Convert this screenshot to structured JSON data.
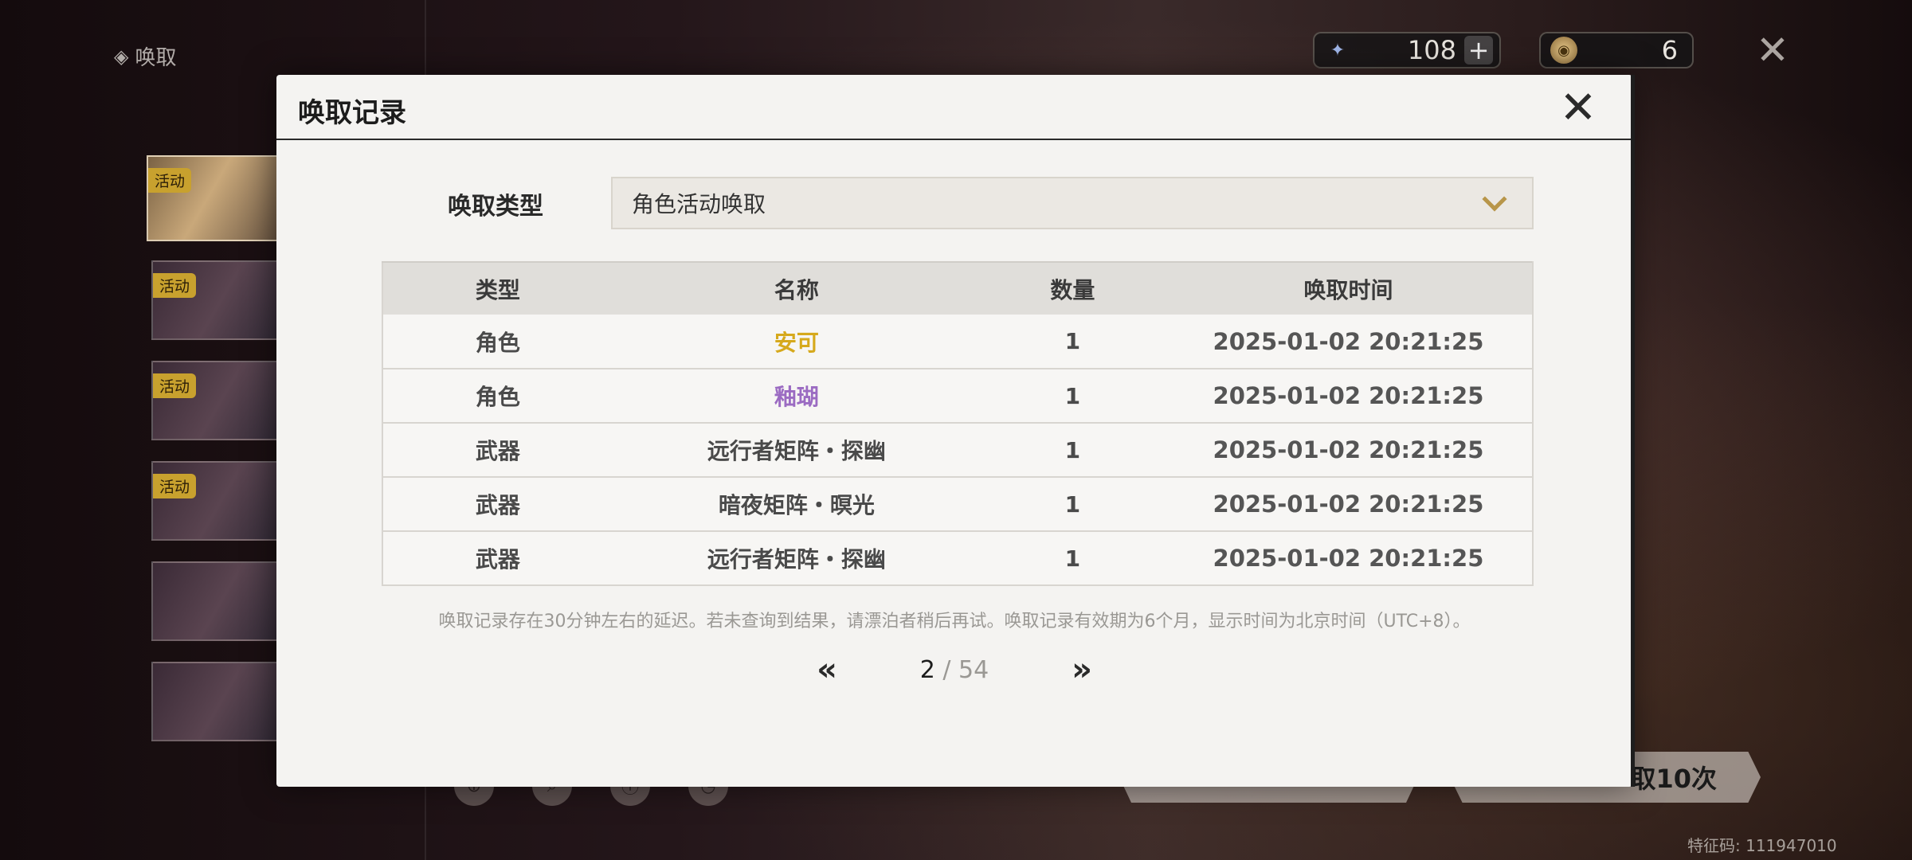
{
  "screen": {
    "title": "唤取",
    "banner_tag": "活动",
    "banners": [
      {
        "tag": "活动"
      },
      {
        "tag": "活动"
      },
      {
        "tag": "活动"
      },
      {
        "tag": "活动"
      },
      {
        "tag": ""
      },
      {
        "tag": ""
      }
    ]
  },
  "currency": {
    "astrite": {
      "icon": "astrite-icon",
      "value": "108"
    },
    "lustrous_tide": {
      "icon": "coin-icon",
      "value": "6"
    }
  },
  "bottom": {
    "pull_ten_label": "取10次",
    "feature_code": "特征码: 111947010"
  },
  "modal": {
    "title": "唤取记录",
    "type_label": "唤取类型",
    "type_value": "角色活动唤取",
    "columns": [
      "类型",
      "名称",
      "数量",
      "唤取时间"
    ],
    "rows": [
      {
        "type": "角色",
        "name": "安可",
        "count": "1",
        "time": "2025-01-02 20:21:25",
        "rarity_color": "#d6a91c"
      },
      {
        "type": "角色",
        "name": "釉瑚",
        "count": "1",
        "time": "2025-01-02 20:21:25",
        "rarity_color": "#9b6bc2"
      },
      {
        "type": "武器",
        "name": "远行者矩阵・探幽",
        "count": "1",
        "time": "2025-01-02 20:21:25"
      },
      {
        "type": "武器",
        "name": "暗夜矩阵・暝光",
        "count": "1",
        "time": "2025-01-02 20:21:25"
      },
      {
        "type": "武器",
        "name": "远行者矩阵・探幽",
        "count": "1",
        "time": "2025-01-02 20:21:25"
      }
    ],
    "footnote": "唤取记录存在30分钟左右的延迟。若未查询到结果，请漂泊者稍后再试。唤取记录有效期为6个月，显示时间为北京时间（UTC+8）。",
    "pager": {
      "current": "2",
      "separator": "/",
      "total": "54"
    }
  },
  "colors": {
    "five_star": "#d6a91c",
    "four_star": "#9b6bc2",
    "accent": "#b8964a"
  }
}
